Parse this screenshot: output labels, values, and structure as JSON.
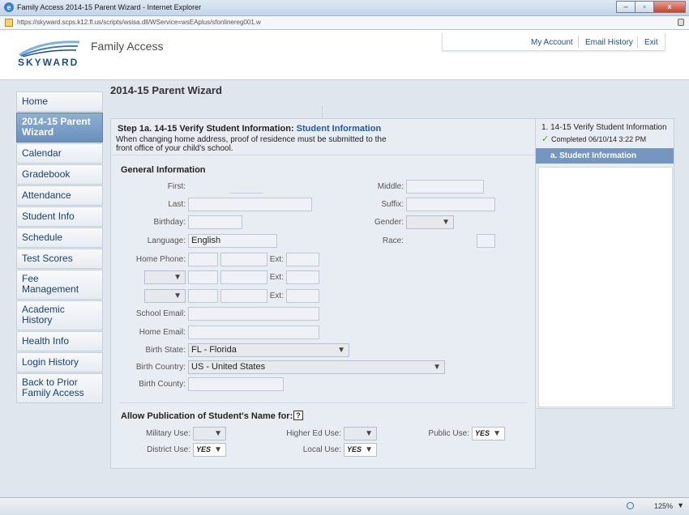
{
  "window": {
    "title": "Family Access 2014-15 Parent Wizard - Internet Explorer",
    "url": "https://skyward.scps.k12.fl.us/scripts/wsisa.dll/WService=wsEAplus/sfonlinereg001.w",
    "zoom": "125%"
  },
  "header": {
    "logo_text": "SKYWARD",
    "brand": "Family Access",
    "links": [
      "My Account",
      "Email History",
      "Exit"
    ]
  },
  "page": {
    "title": "2014-15 Parent Wizard"
  },
  "sidebar": {
    "items": [
      "Home",
      "2014-15 Parent Wizard",
      "Calendar",
      "Gradebook",
      "Attendance",
      "Student Info",
      "Schedule",
      "Test Scores",
      "Fee Management",
      "Academic History",
      "Health Info",
      "Login History",
      "Back to Prior Family Access"
    ],
    "active_index": 1
  },
  "step": {
    "heading": "Step 1a. 14-15 Verify Student Information:",
    "heading_link": "Student Information",
    "note": "When changing home address, proof of residence must be submitted to the front office of your child's school."
  },
  "general": {
    "title": "General Information",
    "labels": {
      "first": "First:",
      "middle": "Middle:",
      "last": "Last:",
      "suffix": "Suffix:",
      "birthday": "Birthday:",
      "gender": "Gender:",
      "language": "Language:",
      "race": "Race:",
      "home_phone": "Home Phone:",
      "ext": "Ext:",
      "school_email": "School Email:",
      "home_email": "Home Email:",
      "birth_state": "Birth State:",
      "birth_country": "Birth Country:",
      "birth_county": "Birth County:"
    },
    "values": {
      "language": "English",
      "birth_state": "FL - Florida",
      "birth_country": "US - United States"
    }
  },
  "publication": {
    "title": "Allow Publication of Student's Name for:",
    "help": "?",
    "labels": {
      "military": "Military Use:",
      "higher_ed": "Higher Ed Use:",
      "public": "Public Use:",
      "district": "District Use:",
      "local": "Local Use:"
    },
    "values": {
      "public": "YES",
      "district": "YES",
      "local": "YES"
    }
  },
  "steps_panel": {
    "step_title": "1. 14-15 Verify Student Information",
    "completed": "Completed 06/10/14 3:22 PM",
    "active_sub": "a. Student Information"
  },
  "chevron": "▼"
}
